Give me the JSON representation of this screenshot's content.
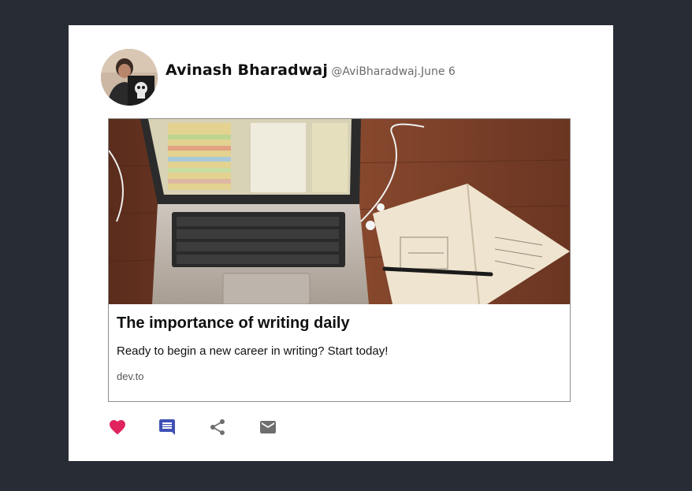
{
  "post": {
    "author_name": "Avinash Bharadwaj",
    "handle": "@AviBharadwaj",
    "date_separator": ".",
    "date": "June 6"
  },
  "link_preview": {
    "title": "The importance of writing daily",
    "description": "Ready to begin a new career in writing? Start today!",
    "domain": "dev.to"
  },
  "actions": [
    {
      "name": "like",
      "icon": "heart-icon",
      "color": "#e0245e"
    },
    {
      "name": "reply",
      "icon": "comment-icon",
      "color": "#3f51b5"
    },
    {
      "name": "share",
      "icon": "share-icon",
      "color": "#6e6e6e"
    },
    {
      "name": "email",
      "icon": "mail-icon",
      "color": "#6e6e6e"
    }
  ],
  "colors": {
    "page_background": "#282c34",
    "card_background": "#ffffff",
    "like": "#e0245e",
    "reply": "#3f51b5",
    "neutral_icon": "#6e6e6e"
  }
}
